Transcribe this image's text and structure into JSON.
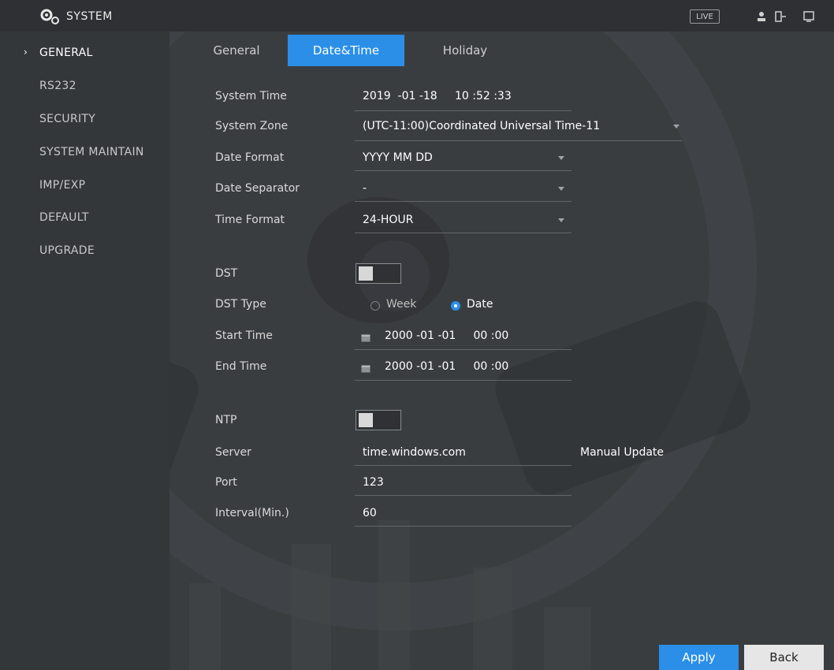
{
  "header": {
    "title": "SYSTEM",
    "live_label": "LIVE",
    "icons": [
      "gear-icon",
      "user-icon",
      "logout-icon",
      "screen-icon"
    ]
  },
  "sidebar": {
    "items": [
      {
        "label": "GENERAL",
        "active": true
      },
      {
        "label": "RS232",
        "active": false
      },
      {
        "label": "SECURITY",
        "active": false
      },
      {
        "label": "SYSTEM MAINTAIN",
        "active": false
      },
      {
        "label": "IMP/EXP",
        "active": false
      },
      {
        "label": "DEFAULT",
        "active": false
      },
      {
        "label": "UPGRADE",
        "active": false
      }
    ]
  },
  "tabs": [
    {
      "label": "General",
      "active": false
    },
    {
      "label": "Date&Time",
      "active": true
    },
    {
      "label": "Holiday",
      "active": false
    }
  ],
  "form": {
    "system_time": {
      "label": "System Time",
      "value": "2019  -01 -18     10 :52 :33"
    },
    "system_zone": {
      "label": "System Zone",
      "value": "(UTC-11:00)Coordinated Universal Time-11"
    },
    "date_format": {
      "label": "Date Format",
      "value": "YYYY MM DD"
    },
    "date_separator": {
      "label": "Date Separator",
      "value": "-"
    },
    "time_format": {
      "label": "Time Format",
      "value": "24-HOUR"
    },
    "dst": {
      "label": "DST",
      "enabled": false
    },
    "dst_type": {
      "label": "DST Type",
      "options": [
        "Week",
        "Date"
      ],
      "selected": "Date"
    },
    "start_time": {
      "label": "Start Time",
      "value": "2000 -01 -01     00 :00"
    },
    "end_time": {
      "label": "End Time",
      "value": "2000 -01 -01     00 :00"
    },
    "ntp": {
      "label": "NTP",
      "enabled": false
    },
    "server": {
      "label": "Server",
      "value": "time.windows.com"
    },
    "manual_update_label": "Manual Update",
    "port": {
      "label": "Port",
      "value": "123"
    },
    "interval": {
      "label": "Interval(Min.)",
      "value": "60"
    }
  },
  "buttons": {
    "apply": "Apply",
    "back": "Back"
  },
  "colors": {
    "accent": "#2b8fe8",
    "background": "#3a3d40",
    "sidebar": "#34373a"
  }
}
